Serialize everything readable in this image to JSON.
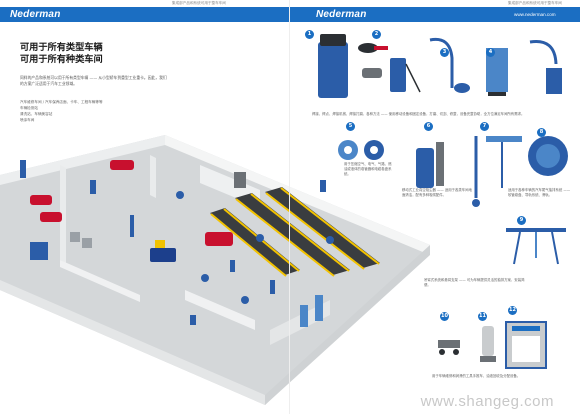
{
  "left_page": {
    "brand": "Nederman",
    "top_note": "集成部产品和系统可用于整车车间",
    "title_lines": [
      "可用于所有类型车辆",
      "可用于所有种类车间"
    ],
    "intro": "同样的产品和系统可以用于所有类型车辆 —— 从小型轿车到重型工业重卡。因此，我们的方案广泛适用于汽车工业领域。",
    "bullets": [
      "汽车维修车间 / 汽车保养店面、卡车、工程车辆等等",
      "车辆检测站",
      "清洗站、车辆美容站",
      "喷涂车间"
    ]
  },
  "right_page": {
    "brand": "Nederman",
    "top_note": "集成部产品和系统可用于整车车间",
    "url": "www.nederman.com",
    "captions": {
      "c1": "焊接、焊点、焊接机械、焊接打磨，各种方法 —— 使用移动设备和固定设备，打磨、切割、修整，设备完整协助，全方位满足车间所有需求。",
      "c2": "用于压缩空气、电气、气路、燃油或液体的卷管器和电缆卷盘系统。",
      "c3": "移动式工业真空吸尘器 —— 适用于各类车间地面清洁，配有多种吸嘴配件。",
      "c4": "适用于各种车辆的汽车尾气抽排系统 —— 软管卷盘、导轨系统、滑轨。",
      "c5": "吊臂式系统和悬臂支架 —— 可为车辆提供灵活的抽排方案，安装简便。",
      "c6": "用于车辆维修和润滑的工具手推车、油液回收及分配设备。"
    },
    "watermark": "www.shangeg.com"
  },
  "badges": [
    "1",
    "2",
    "3",
    "4",
    "5",
    "6",
    "7",
    "8",
    "9",
    "10",
    "11",
    "12",
    "13"
  ],
  "colors": {
    "brand_blue": "#1b6ec2",
    "accent_yellow": "#f2c200",
    "floor_gray": "#c9ccce"
  }
}
